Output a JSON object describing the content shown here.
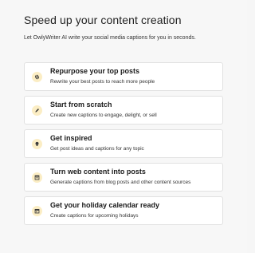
{
  "header": {
    "title": "Speed up your content creation",
    "subtitle": "Let OwlyWriter AI write your social media captions for you in seconds."
  },
  "colors": {
    "icon_bg": "#fbedc4",
    "icon_fg": "#3a3a3a",
    "card_border": "#e1e1e1"
  },
  "options": [
    {
      "label": "Repurpose your top posts",
      "description": "Rewrite your best posts to reach more people",
      "icon": "repurpose-icon"
    },
    {
      "label": "Start from scratch",
      "description": "Create new captions to engage, delight, or sell",
      "icon": "pencil-icon"
    },
    {
      "label": "Get inspired",
      "description": "Get post ideas and captions for any topic",
      "icon": "lightbulb-icon"
    },
    {
      "label": "Turn web content into posts",
      "description": "Generate captions from blog posts and other content sources",
      "icon": "web-content-icon"
    },
    {
      "label": "Get your holiday calendar ready",
      "description": "Create captions for upcoming holidays",
      "icon": "calendar-icon"
    }
  ]
}
